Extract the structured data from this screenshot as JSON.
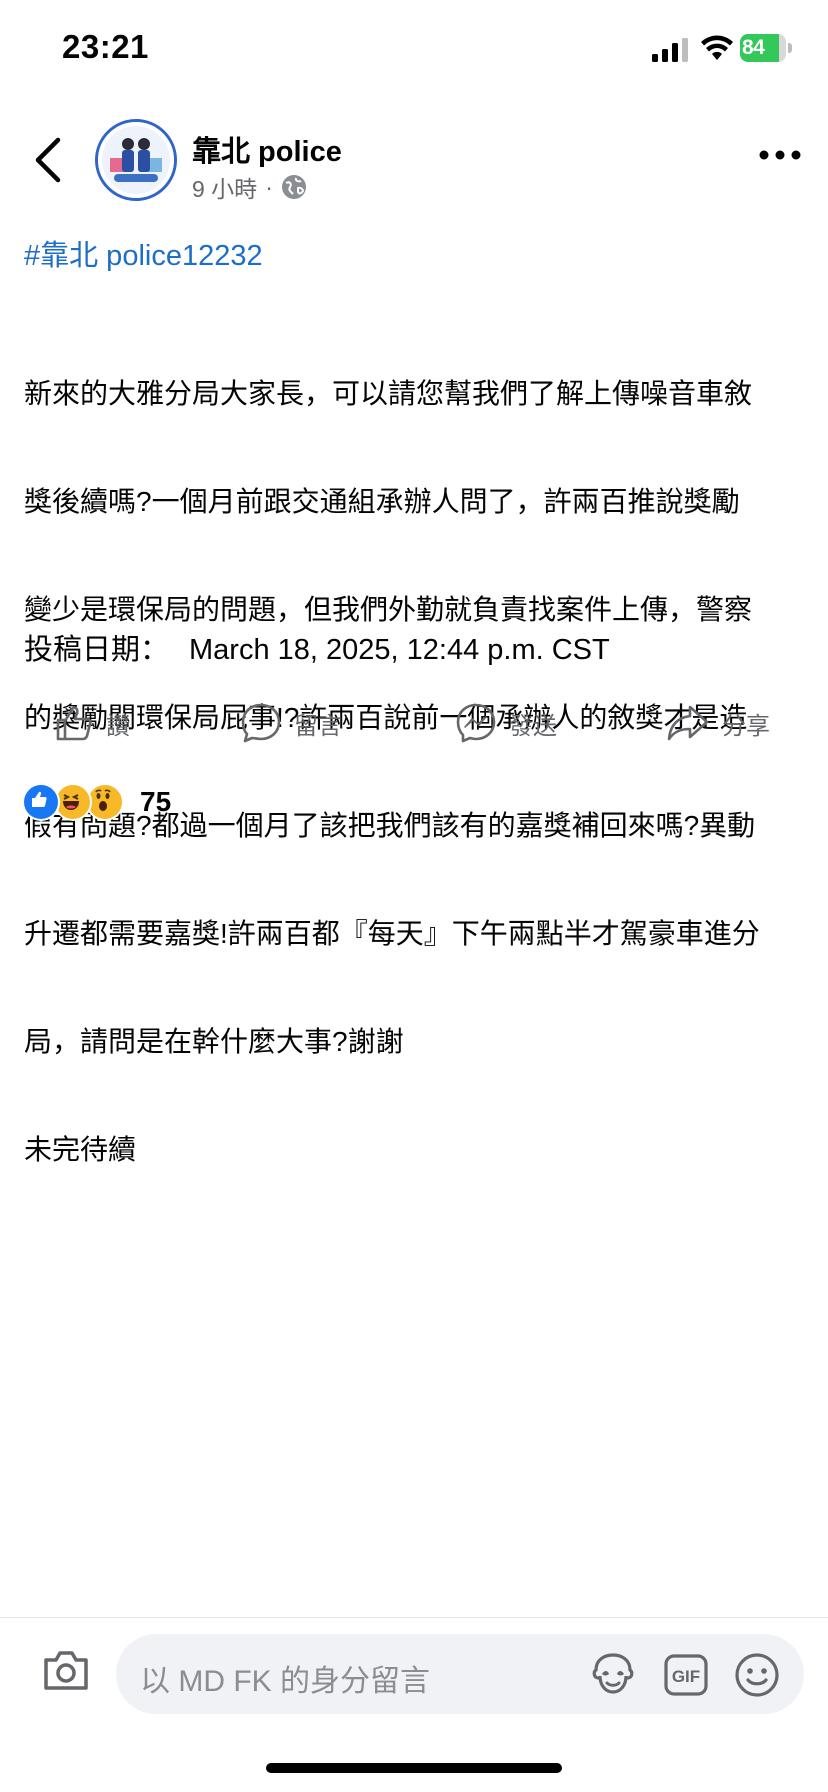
{
  "status_bar": {
    "time": "23:21",
    "battery_level": "84",
    "battery_fraction": 0.84,
    "battery_color": "#34c759"
  },
  "post": {
    "author": "靠北 police",
    "time_ago": "9 小時",
    "separator": "·",
    "audience_icon": "globe-icon",
    "hashtag": "#靠北 police12232",
    "body_lines": [
      "新來的大雅分局大家長，可以請您幫我們了解上傳噪音車敘",
      "獎後續嗎?一個月前跟交通組承辦人問了，許兩百推說獎勵",
      "變少是環保局的問題，但我們外勤就負責找案件上傳，警察",
      "的獎勵關環保局屁事!?許兩百說前一個承辦人的敘獎才是造",
      "假有問題?都過一個月了該把我們該有的嘉獎補回來嗎?異動",
      "升遷都需要嘉獎!許兩百都『每天』下午兩點半才駕豪車進分",
      "局，請問是在幹什麼大事?謝謝",
      "未完待續"
    ],
    "date_label": "投稿日期：",
    "date_value": "March 18, 2025, 12:44 p.m. CST"
  },
  "actions": {
    "like": "讚",
    "comment": "留言",
    "send": "發送",
    "share": "分享"
  },
  "reactions": {
    "types": [
      "like",
      "haha",
      "wow"
    ],
    "count": "75"
  },
  "comment_bar": {
    "placeholder": "以 MD FK 的身分留言",
    "gif_label": "GIF"
  },
  "colors": {
    "link_blue": "#1d6ec9",
    "facebook_blue": "#1877f2",
    "secondary_text": "#65676b",
    "input_bg": "#f0f2f5"
  }
}
